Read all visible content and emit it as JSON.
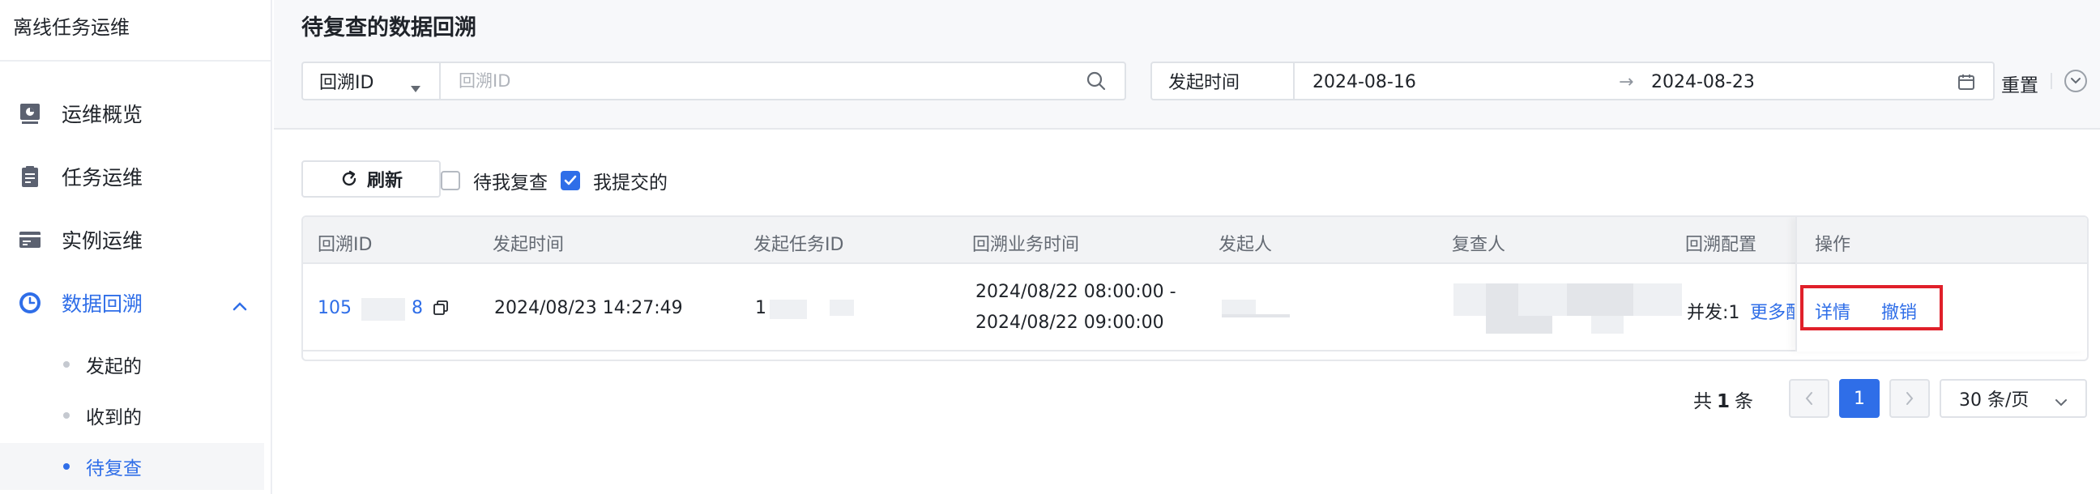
{
  "sidebar": {
    "title": "离线任务运维",
    "items": [
      {
        "label": "运维概览",
        "icon": "dashboard-icon"
      },
      {
        "label": "任务运维",
        "icon": "task-clipboard-icon"
      },
      {
        "label": "实例运维",
        "icon": "instance-card-icon"
      },
      {
        "label": "数据回溯",
        "icon": "clock-icon"
      }
    ],
    "subitems": [
      {
        "label": "发起的"
      },
      {
        "label": "收到的"
      },
      {
        "label": "待复查"
      }
    ]
  },
  "main": {
    "title": "待复查的数据回溯",
    "filter": {
      "select_label": "回溯ID",
      "search_placeholder": "回溯ID",
      "date_label": "发起时间",
      "date_start": "2024-08-16",
      "date_end": "2024-08-23",
      "date_arrow": "→",
      "reset_label": "重置"
    },
    "toolbar": {
      "refresh_label": "刷新",
      "check1_label": "待我复查",
      "check2_label": "我提交的"
    },
    "table": {
      "headers": [
        "回溯ID",
        "发起时间",
        "发起任务ID",
        "回溯业务时间",
        "发起人",
        "复查人",
        "回溯配置",
        "操作"
      ],
      "row": {
        "id_prefix": "105",
        "id_suffix": "8",
        "start_time": "2024/08/23 14:27:49",
        "task_id": "1",
        "biz_time_from": "2024/08/22 08:00:00 -",
        "biz_time_to": "2024/08/22 09:00:00",
        "config": "并发:1",
        "more": "更多配",
        "op_detail": "详情",
        "op_revoke": "撤销"
      }
    },
    "pagination": {
      "total_prefix": "共",
      "total_count": "1",
      "total_suffix": "条",
      "current_page": "1",
      "page_size": "30 条/页"
    }
  },
  "colors": {
    "accent": "#2f6ee8",
    "highlight": "#e0202a"
  }
}
